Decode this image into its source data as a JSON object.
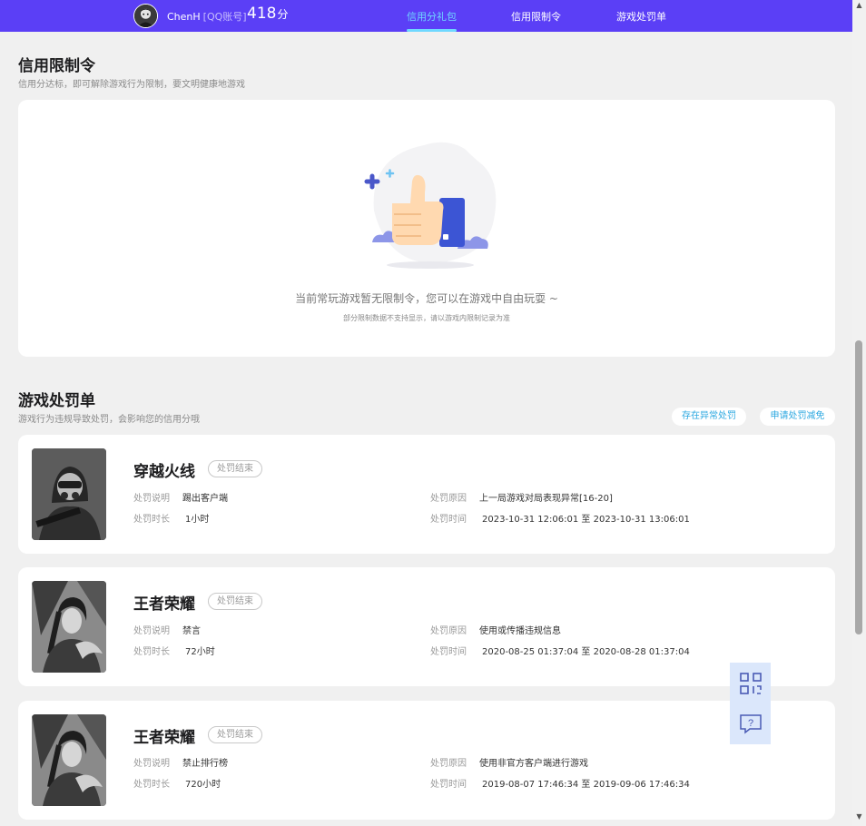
{
  "header": {
    "user_name": "ChenH",
    "account_type": "[QQ账号]",
    "score": "418",
    "score_unit": "分",
    "tabs": [
      {
        "label": "信用分礼包",
        "active": true
      },
      {
        "label": "信用限制令",
        "active": false
      },
      {
        "label": "游戏处罚单",
        "active": false
      }
    ],
    "accent_color": "#5b3ff6",
    "active_tab_color": "#6fd8ff"
  },
  "restrictions": {
    "title": "信用限制令",
    "subtitle": "信用分达标，即可解除游戏行为限制，要文明健康地游戏",
    "empty_message": "当前常玩游戏暂无限制令，您可以在游戏中自由玩耍 ~",
    "empty_note": "部分限制数据不支持显示，请以游戏内限制记录为准"
  },
  "penalties": {
    "title": "游戏处罚单",
    "subtitle": "游戏行为违规导致处罚，会影响您的信用分哦",
    "actions": {
      "report_abnormal": "存在异常处罚",
      "apply_reduction": "申请处罚减免"
    },
    "labels": {
      "desc": "处罚说明",
      "duration": "处罚时长",
      "reason": "处罚原因",
      "time": "处罚时间",
      "to": "至"
    },
    "items": [
      {
        "game": "穿越火线",
        "status": "处罚结束",
        "desc": "踢出客户端",
        "duration": "1小时",
        "reason": "上一局游戏对局表现异常[16-20]",
        "start": "2023-10-31 12:06:01",
        "end": "2023-10-31 13:06:01"
      },
      {
        "game": "王者荣耀",
        "status": "处罚结束",
        "desc": "禁言",
        "duration": "72小时",
        "reason": "使用或传播违规信息",
        "start": "2020-08-25 01:37:04",
        "end": "2020-08-28 01:37:04"
      },
      {
        "game": "王者荣耀",
        "status": "处罚结束",
        "desc": "禁止排行榜",
        "duration": "720小时",
        "reason": "使用非官方客户端进行游戏",
        "start": "2019-08-07 17:46:34",
        "end": "2019-09-06 17:46:34"
      }
    ]
  },
  "floating": {
    "qr_icon": "qr-code-icon",
    "feedback_icon": "help-chat-icon"
  }
}
